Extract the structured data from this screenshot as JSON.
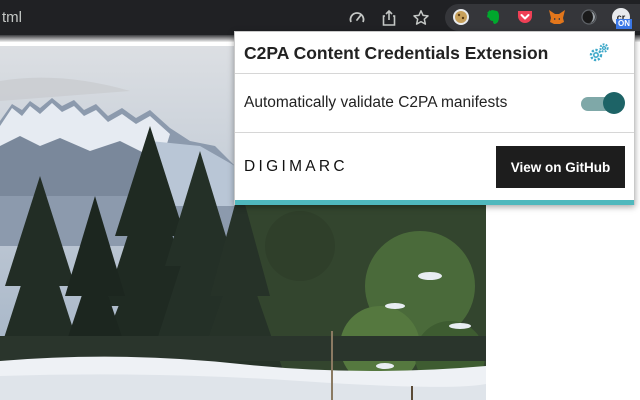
{
  "browser": {
    "url_fragment": "tml",
    "extension_badge": "ON",
    "extension_badge_color": "#3b78e7"
  },
  "popup": {
    "title": "C2PA Content Credentials Extension",
    "settings_icon": "gears-icon",
    "auto_validate": {
      "label": "Automatically validate C2PA manifests",
      "enabled": true
    },
    "brand_logo": "DIGIMARC",
    "github_button_label": "View on GitHub",
    "accent_color": "#1d6366",
    "bar_color": "#4fb8bd"
  }
}
